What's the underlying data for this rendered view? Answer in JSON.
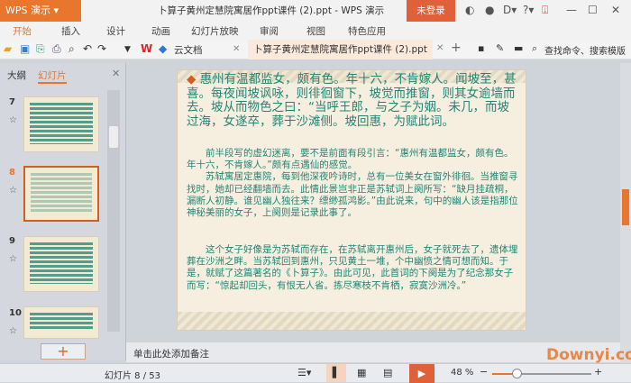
{
  "app": {
    "menu_button": "WPS 演示",
    "title": "卜算子黄州定慧院寓居作ppt课件 (2).ppt - WPS 演示",
    "login": "未登录"
  },
  "ribbon_tabs": [
    "开始",
    "插入",
    "设计",
    "动画",
    "幻灯片放映",
    "审阅",
    "视图",
    "特色应用"
  ],
  "toolbar": {
    "cloud_docs": "云文档",
    "doc_tab": "卜算子黄州定慧院寓居作ppt课件 (2).ppt",
    "search": "查找命令、搜索模版"
  },
  "left_pane": {
    "tab_outline": "大纲",
    "tab_slides": "幻灯片",
    "slides": [
      "7",
      "8",
      "9",
      "10"
    ],
    "selected": "8"
  },
  "slide": {
    "para0": "惠州有温都监女，颇有色。年十六，不肯嫁人。闻坡至，甚喜。每夜闻坡讽咏，则徘徊窗下，坡觉而推窗，则其女逾墙而去。坡从而物色之曰：“当呼王郎，与之子为姻。未几，而坡过海，女遂卒，葬于沙滩侧。坡回惠，为赋此词。",
    "para1a": "前半段写的虚幻迷离，要不是前面有段引言：“惠州有温都监女，颇有色。年十六，不肯嫁人。”颇有点遇仙的感觉。",
    "para1b": "苏轼寓居定惠院，每到他深夜吟诗时，总有一位美女在窗外徘徊。当推窗寻找时，她却已经翻墙而去。此情此景岂非正是苏轼词上阕所写：“缺月挂疏桐，漏断人初静。谁见幽人独往来？缥缈孤鸿影。”由此说来，句中的幽人该是指那位神秘美丽的女子，上阕则是记录此事了。",
    "para2": "这个女子好像是为苏轼而存在，在苏轼离开惠州后，女子就死去了，遗体埋葬在沙洲之畔。当苏轼回到惠州，只见黄土一堆，个中幽愤之情可想而知。于是，就赋了这篇著名的《卜算子》。由此可见，此首词的下阕是为了纪念那女子而写：“惊起却回头，有恨无人省。拣尽寒枝不肯栖，寂寞沙洲冷。”"
  },
  "notes_placeholder": "单击此处添加备注",
  "status": {
    "slide_counter": "幻灯片 8 / 53",
    "zoom": "48 %",
    "zoom_percent": 48
  },
  "watermark": "Downyi.com"
}
